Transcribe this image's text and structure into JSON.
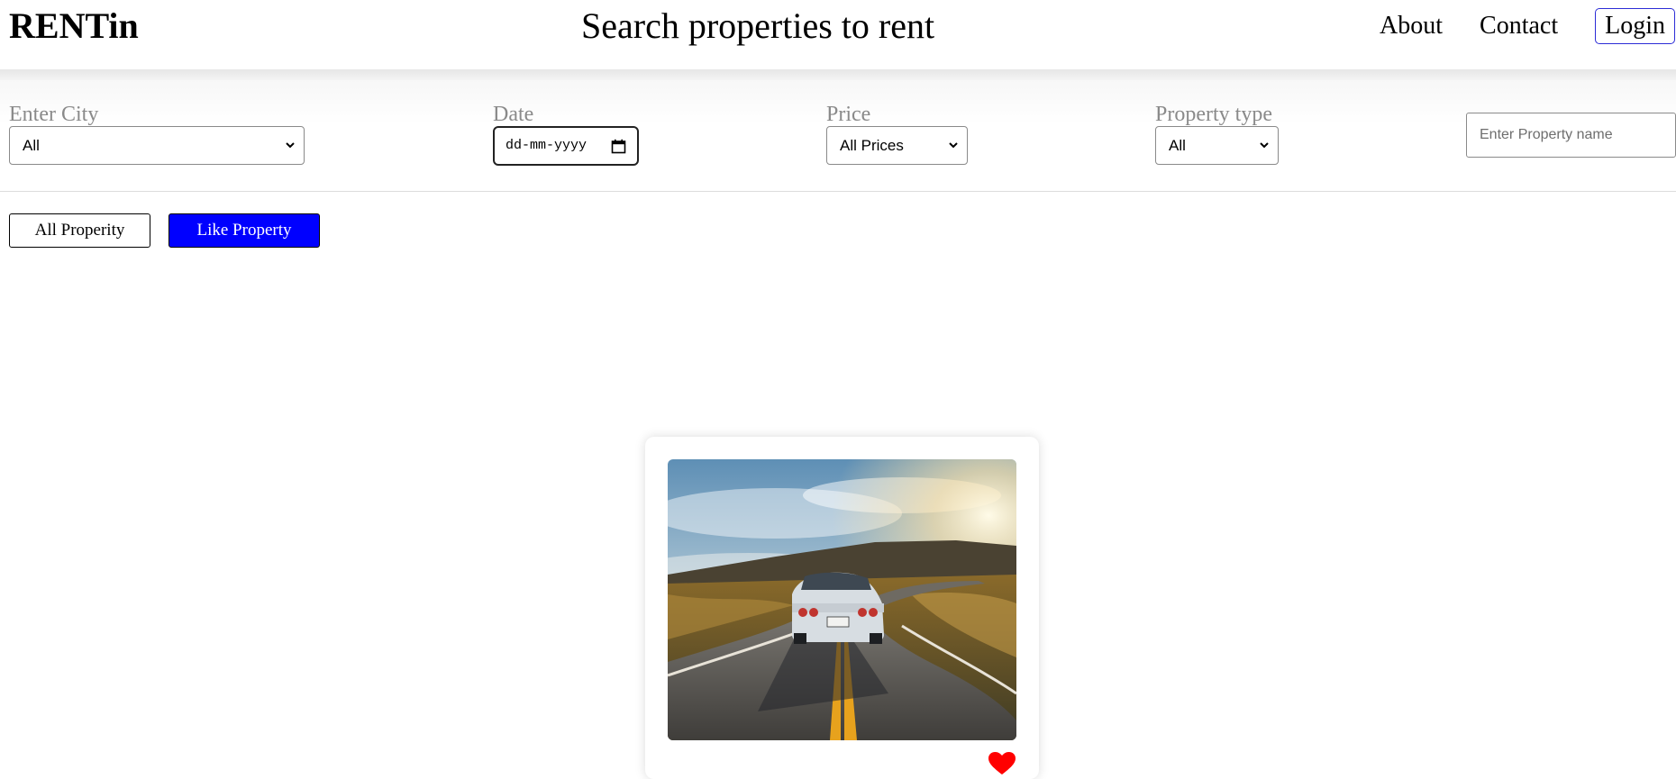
{
  "header": {
    "logo": "RENTin",
    "title": "Search properties to rent",
    "nav": {
      "about": "About",
      "contact": "Contact",
      "login": "Login"
    }
  },
  "filters": {
    "city": {
      "label": "Enter City",
      "value": "All"
    },
    "date": {
      "label": "Date",
      "value": "dd-mm-yyyy"
    },
    "price": {
      "label": "Price",
      "value": "All Prices"
    },
    "property_type": {
      "label": "Property type",
      "value": "All"
    },
    "name_search": {
      "placeholder": "Enter Property name"
    }
  },
  "toggles": {
    "all": "All Properity",
    "like": "Like Property",
    "active": "like",
    "active_color": "#0000ff"
  },
  "card": {
    "image": "car-on-road-at-sunset",
    "liked": true,
    "heart_color": "#ff0000"
  },
  "icons": {
    "dropdown": "chevron-down-icon",
    "calendar": "calendar-icon",
    "like": "heart-icon"
  }
}
